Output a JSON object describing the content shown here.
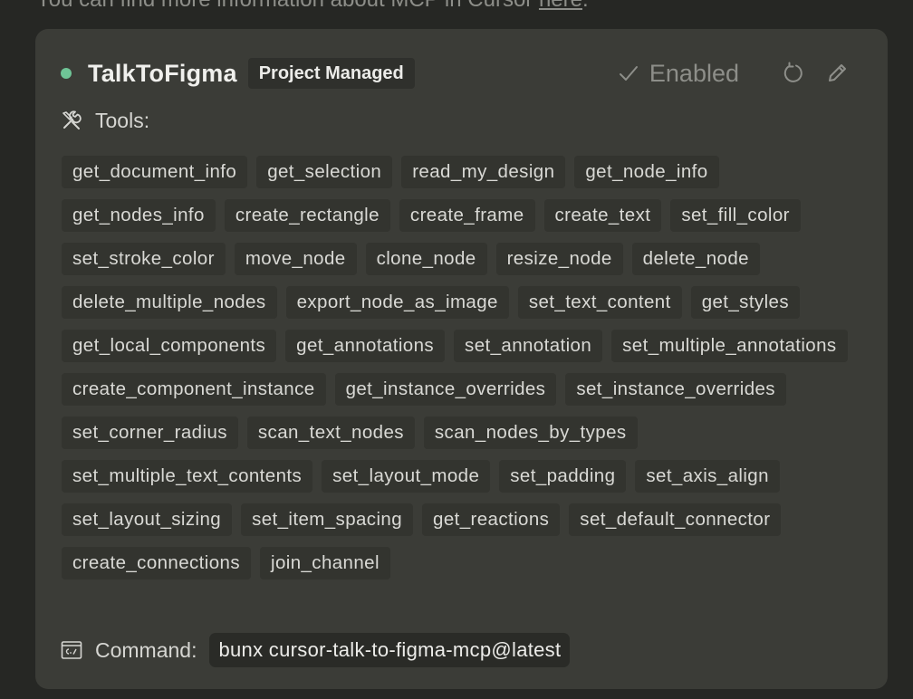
{
  "intro": {
    "text_before_link": "You can find more information about MCP in Cursor ",
    "link_text": "here",
    "text_after_link": "."
  },
  "server": {
    "name": "TalkToFigma",
    "badge": "Project Managed",
    "status_color": "#6fc496",
    "enabled_label": "Enabled"
  },
  "tools": {
    "label": "Tools:",
    "items": [
      "get_document_info",
      "get_selection",
      "read_my_design",
      "get_node_info",
      "get_nodes_info",
      "create_rectangle",
      "create_frame",
      "create_text",
      "set_fill_color",
      "set_stroke_color",
      "move_node",
      "clone_node",
      "resize_node",
      "delete_node",
      "delete_multiple_nodes",
      "export_node_as_image",
      "set_text_content",
      "get_styles",
      "get_local_components",
      "get_annotations",
      "set_annotation",
      "set_multiple_annotations",
      "create_component_instance",
      "get_instance_overrides",
      "set_instance_overrides",
      "set_corner_radius",
      "scan_text_nodes",
      "scan_nodes_by_types",
      "set_multiple_text_contents",
      "set_layout_mode",
      "set_padding",
      "set_axis_align",
      "set_layout_sizing",
      "set_item_spacing",
      "get_reactions",
      "set_default_connector",
      "create_connections",
      "join_channel"
    ]
  },
  "command": {
    "label": "Command:",
    "value": "bunx cursor-talk-to-figma-mcp@latest"
  }
}
